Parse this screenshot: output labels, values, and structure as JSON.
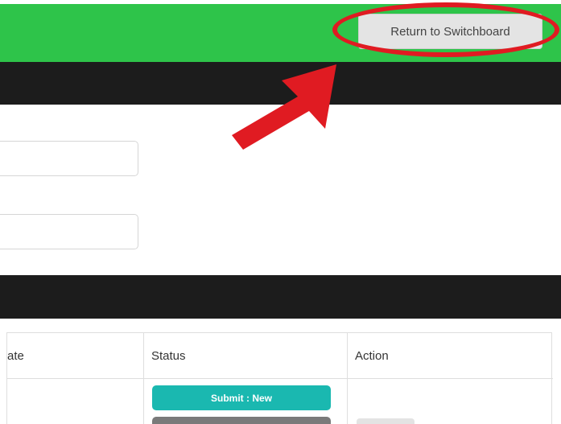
{
  "header": {
    "return_button_label": "Return to Switchboard"
  },
  "table": {
    "columns": [
      "ate",
      "Status",
      "Action"
    ],
    "rows": [
      {
        "status_badge": "Submit : New"
      }
    ]
  },
  "colors": {
    "header_green": "#2ec44a",
    "dark_bar": "#1c1c1c",
    "annotation_red": "#e01b22",
    "badge_teal": "#1ab8b0"
  },
  "icons": [
    "red-arrow-annotation-icon",
    "red-ellipse-annotation"
  ]
}
